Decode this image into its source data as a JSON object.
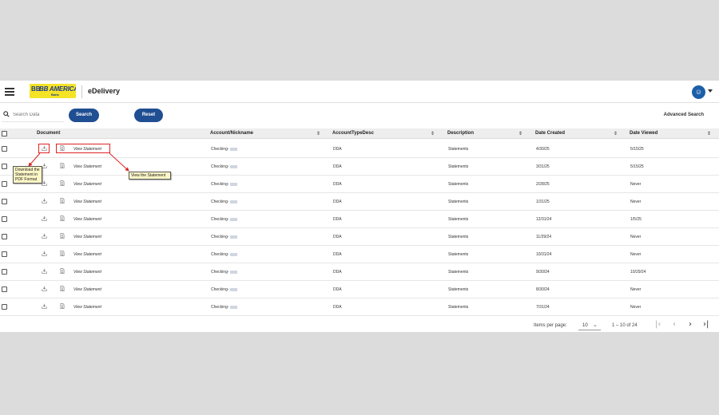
{
  "header": {
    "brand_mark": "BB",
    "brand_name": "BB AMERICAS",
    "brand_sub": "Bank",
    "app_title": "eDelivery",
    "avatar_glyph": "☺"
  },
  "search": {
    "placeholder": "Search Data",
    "search_label": "Search",
    "reset_label": "Reset",
    "advanced_label": "Advanced Search"
  },
  "table": {
    "headers": {
      "document": "Document",
      "account": "Account/Nickname",
      "type": "AccountTypeDesc",
      "description": "Description",
      "created": "Date Created",
      "viewed": "Date Viewed"
    },
    "sort_glyph": "⇕",
    "rows": [
      {
        "link": "View Statement",
        "account": "Checking-",
        "type": "DDA",
        "description": "Statements",
        "created": "4/30/25",
        "viewed": "5/15/25"
      },
      {
        "link": "View Statement",
        "account": "Checking-",
        "type": "DDA",
        "description": "Statements",
        "created": "3/31/25",
        "viewed": "5/15/25"
      },
      {
        "link": "View Statement",
        "account": "Checking-",
        "type": "DDA",
        "description": "Statements",
        "created": "2/28/25",
        "viewed": "Never"
      },
      {
        "link": "View Statement",
        "account": "Checking-",
        "type": "DDA",
        "description": "Statements",
        "created": "1/31/25",
        "viewed": "Never"
      },
      {
        "link": "View Statement",
        "account": "Checking-",
        "type": "DDA",
        "description": "Statements",
        "created": "12/31/24",
        "viewed": "1/5/25"
      },
      {
        "link": "View Statement",
        "account": "Checking-",
        "type": "DDA",
        "description": "Statements",
        "created": "11/29/24",
        "viewed": "Never"
      },
      {
        "link": "View Statement",
        "account": "Checking-",
        "type": "DDA",
        "description": "Statements",
        "created": "10/31/24",
        "viewed": "Never"
      },
      {
        "link": "View Statement",
        "account": "Checking-",
        "type": "DDA",
        "description": "Statements",
        "created": "9/30/24",
        "viewed": "10/29/24"
      },
      {
        "link": "View Statement",
        "account": "Checking-",
        "type": "DDA",
        "description": "Statements",
        "created": "8/30/24",
        "viewed": "Never"
      },
      {
        "link": "View Statement",
        "account": "Checking-",
        "type": "DDA",
        "description": "Statements",
        "created": "7/31/24",
        "viewed": "Never"
      }
    ]
  },
  "annotations": {
    "download_note": "Download the Statement in PDF Format",
    "view_note": "View the Statement",
    "highlight_color": "#e02424"
  },
  "pagination": {
    "items_per_page_label": "Items per page:",
    "items_per_page_value": "10",
    "range_label": "1 – 10 of 24"
  }
}
